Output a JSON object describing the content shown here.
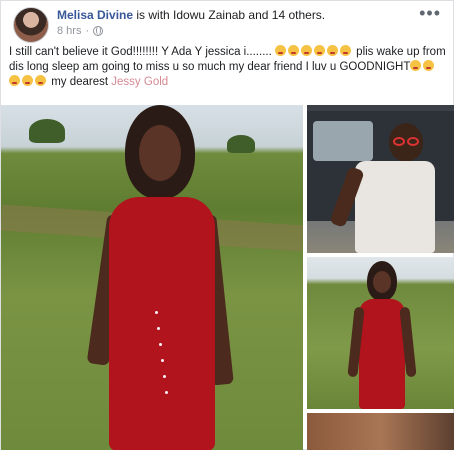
{
  "post": {
    "author": "Melisa Divine",
    "with_text": " is with Idowu Zainab and 14 others.",
    "time": "8 hrs",
    "time_sep": " · ",
    "more_icon": "ellipsis-icon",
    "privacy_icon": "globe-icon",
    "caption_part1": "I still can't believe it God!!!!!!!! Y Ada Y jessica i........ ",
    "caption_part2": " plis wake up from dis long sleep am going to miss u so much my dear friend I luv u GOODNIGHT",
    "caption_part3": " my dearest ",
    "mention": "Jessy Gold",
    "emoji_count_1": 6,
    "emoji_count_2": 5
  },
  "colors": {
    "link": "#385898",
    "mention": "#d48a93",
    "dress": "#b1141c"
  }
}
